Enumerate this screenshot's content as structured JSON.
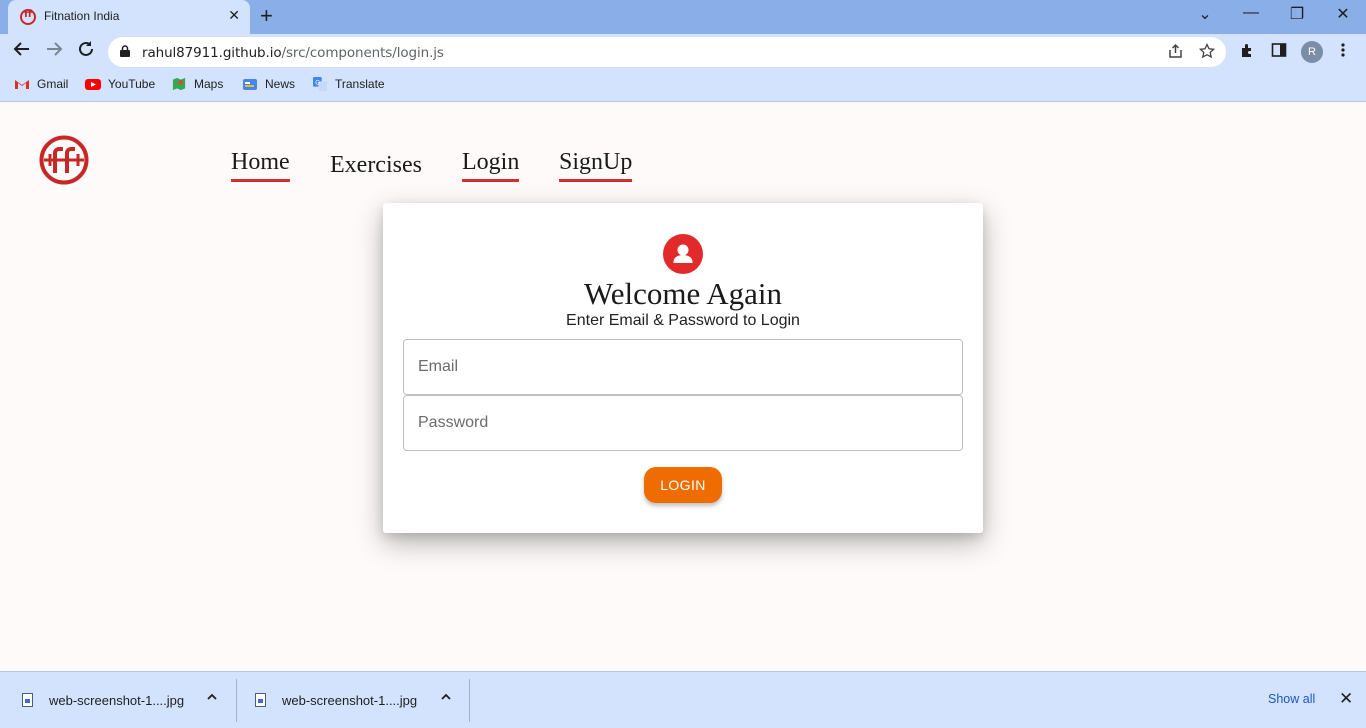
{
  "browser": {
    "tab_title": "Fitnation India",
    "tab_close": "✕",
    "new_tab": "+",
    "window_controls": {
      "dropdown": "⌄",
      "minimize": "—",
      "restore": "❐",
      "close": "✕"
    },
    "url_host": "rahul87911.github.io",
    "url_path": "/src/components/login.js",
    "profile_initial": "R",
    "bookmarks": [
      {
        "label": "Gmail",
        "icon": "gmail-icon",
        "color": "#d93025"
      },
      {
        "label": "YouTube",
        "icon": "youtube-icon",
        "color": "#ff0000"
      },
      {
        "label": "Maps",
        "icon": "maps-icon",
        "color": "#34a853"
      },
      {
        "label": "News",
        "icon": "news-icon",
        "color": "#4285f4"
      },
      {
        "label": "Translate",
        "icon": "translate-icon",
        "color": "#4285f4"
      }
    ]
  },
  "nav": {
    "home": "Home",
    "exercises": "Exercises",
    "login": "Login",
    "signup": "SignUp"
  },
  "login_card": {
    "title": "Welcome Again",
    "subtitle": "Enter Email & Password to Login",
    "email_placeholder": "Email",
    "password_placeholder": "Password",
    "button_label": "LOGIN"
  },
  "downloads": {
    "items": [
      {
        "name": "web-screenshot-1....jpg"
      },
      {
        "name": "web-screenshot-1....jpg"
      }
    ],
    "show_all": "Show all",
    "close": "✕"
  },
  "colors": {
    "accent_red": "#d32f2f",
    "login_button": "#ef6c00",
    "page_background": "#fefafa",
    "chrome_blue": "#d3e3fd"
  }
}
